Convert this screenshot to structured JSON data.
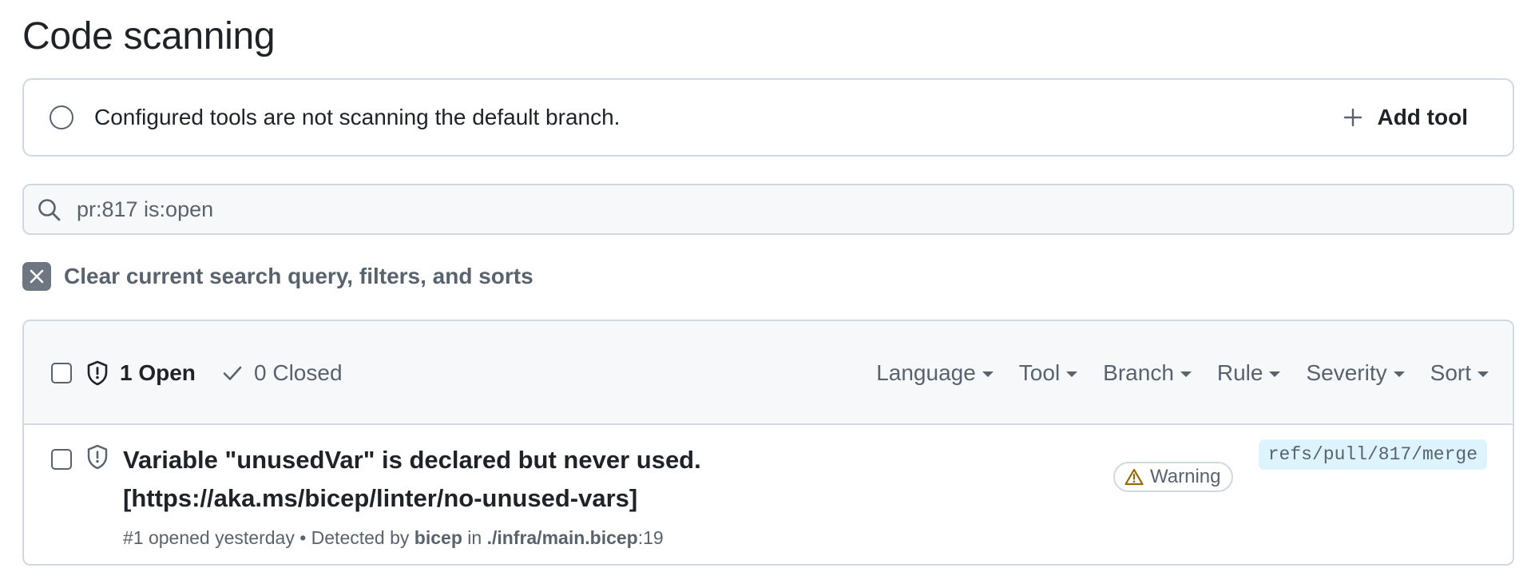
{
  "page": {
    "title": "Code scanning"
  },
  "banner": {
    "message": "Configured tools are not scanning the default branch.",
    "add_tool_label": "Add tool"
  },
  "search": {
    "value": "pr:817 is:open"
  },
  "clear_filters": {
    "label": "Clear current search query, filters, and sorts"
  },
  "list_header": {
    "open_label": "1 Open",
    "closed_label": "0 Closed",
    "filters": [
      {
        "label": "Language"
      },
      {
        "label": "Tool"
      },
      {
        "label": "Branch"
      },
      {
        "label": "Rule"
      },
      {
        "label": "Severity"
      },
      {
        "label": "Sort"
      }
    ]
  },
  "alerts": [
    {
      "title_line1": "Variable \"unusedVar\" is declared but never used.",
      "title_line2": "[https://aka.ms/bicep/linter/no-unused-vars]",
      "meta_prefix": "#1 opened yesterday • Detected by ",
      "tool": "bicep",
      "meta_in": " in ",
      "file": "./infra/main.bicep",
      "line": ":19",
      "severity": "Warning",
      "branch": "refs/pull/817/merge"
    }
  ],
  "colors": {
    "text_primary": "#1f2328",
    "text_muted": "#59636e",
    "border": "#d1d9e0",
    "header_bg": "#f6f8fa",
    "branch_bg": "#ddf4ff",
    "warning_icon": "#9a6700"
  },
  "icons": {
    "banner_status": "circle-icon",
    "add_tool": "plus-icon",
    "search": "search-icon",
    "clear": "x-icon",
    "open": "shield-icon",
    "closed": "check-icon",
    "alert": "shield-icon",
    "severity": "alert-triangle-icon",
    "dropdown": "triangle-down-icon"
  }
}
